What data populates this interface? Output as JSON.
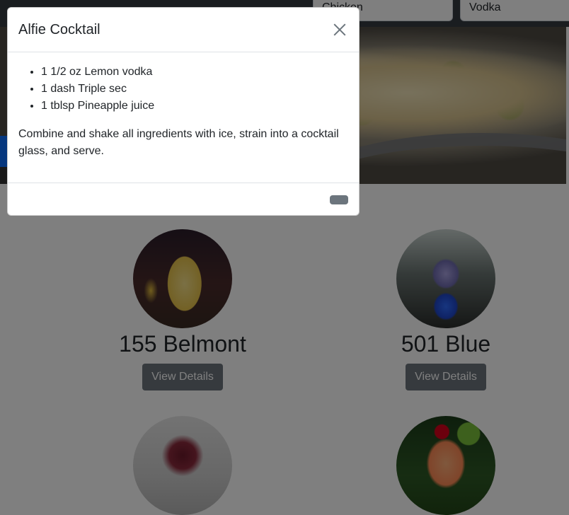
{
  "search": {
    "ingredient_value": "Chicken",
    "spirit_value": "Vodka"
  },
  "cocktails": [
    {
      "name": "155 Belmont",
      "button_label": "View Details",
      "image": "orange-highball-drink"
    },
    {
      "name": "501 Blue",
      "button_label": "View Details",
      "image": "blue-layered-drink"
    },
    {
      "name": "",
      "button_label": "",
      "image": "red-rocks-drink"
    },
    {
      "name": "",
      "button_label": "",
      "image": "orange-cherry-kiwi-drink"
    }
  ],
  "modal": {
    "title": "Alfie Cocktail",
    "ingredients": [
      "1 1/2 oz Lemon vodka",
      "1 dash Triple sec",
      "1 tblsp Pineapple juice"
    ],
    "instructions": "Combine and shake all ingredients with ice, strain into a cocktail glass, and serve.",
    "close_icon": "close-icon",
    "footer_button_label": ""
  },
  "colors": {
    "primary": "#0d6efd",
    "secondary": "#6c757d",
    "dark": "#343a40",
    "backdrop": "rgba(0,0,0,0.5)"
  }
}
